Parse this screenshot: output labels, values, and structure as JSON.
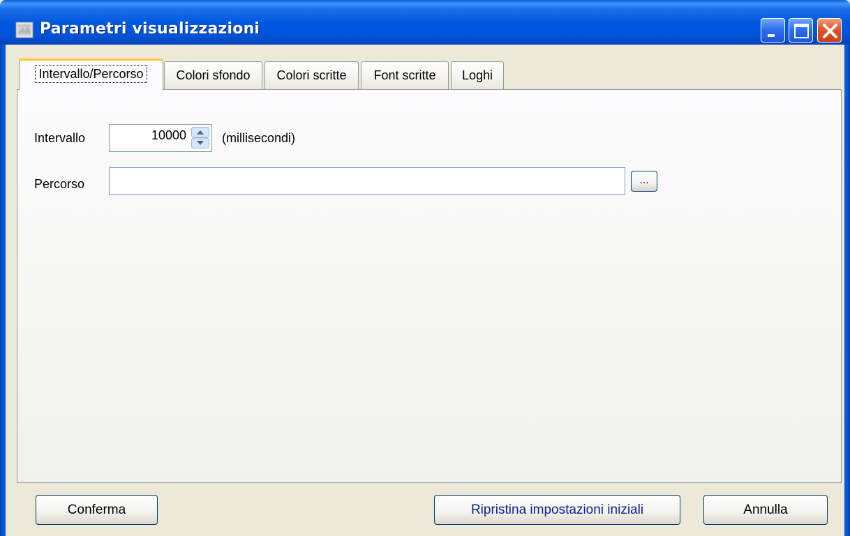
{
  "window": {
    "title": "Parametri visualizzazioni",
    "icon": "app-window-icon",
    "controls": [
      "minimize-icon",
      "maximize-icon",
      "close-icon"
    ],
    "colors": {
      "titlebar": "#0058E0",
      "close_button": "#E0542A",
      "body": "#ECE9D8",
      "active_tab_accent": "#FFC83C"
    }
  },
  "tabs": [
    {
      "label": "Intervallo/Percorso",
      "active": true
    },
    {
      "label": "Colori sfondo",
      "active": false
    },
    {
      "label": "Colori scritte",
      "active": false
    },
    {
      "label": "Font scritte",
      "active": false
    },
    {
      "label": "Loghi",
      "active": false
    }
  ],
  "form": {
    "interval": {
      "label": "Intervallo",
      "value": "10000",
      "unit": "(millisecondi)"
    },
    "path": {
      "label": "Percorso",
      "value": "",
      "browse_label": "..."
    }
  },
  "buttons": {
    "confirm": "Conferma",
    "reset": "Ripristina impostazioni iniziali",
    "cancel": "Annulla"
  }
}
